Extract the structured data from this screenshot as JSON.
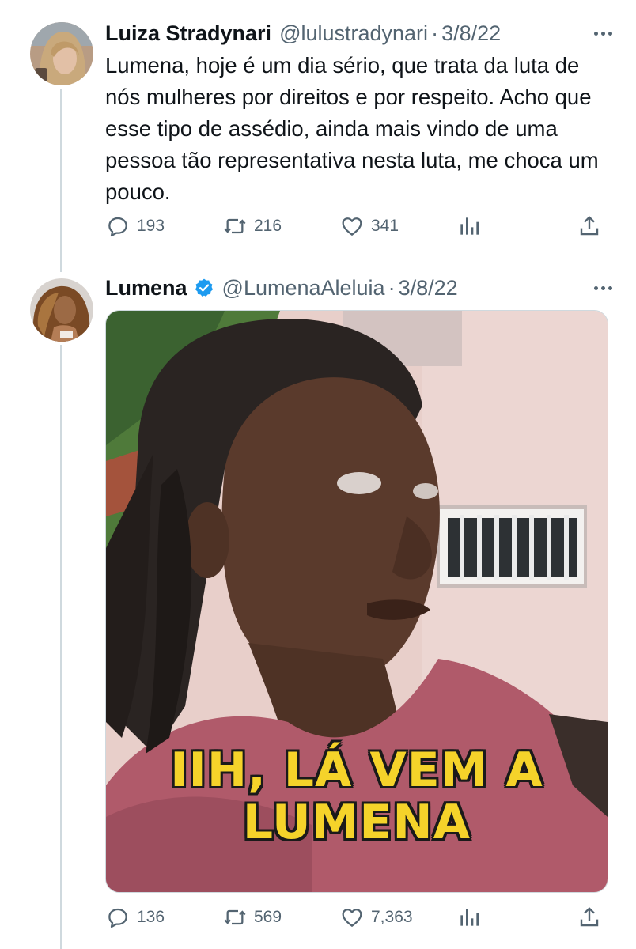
{
  "tweets": [
    {
      "name": "Luiza Stradynari",
      "handle": "@lulustradynari",
      "separator": "·",
      "date": "3/8/22",
      "verified": false,
      "text": "Lumena, hoje é um dia sério, que trata da luta de nós mulheres por direitos e por respeito. Acho que esse tipo de assédio, ainda mais vindo de uma pessoa tão representativa nesta luta, me choca um pouco.",
      "replies": "193",
      "retweets": "216",
      "likes": "341",
      "icons": [
        "reply-icon",
        "retweet-icon",
        "like-icon",
        "views-icon",
        "share-icon"
      ]
    },
    {
      "name": "Lumena",
      "handle": "@LumenaAleluia",
      "separator": "·",
      "date": "3/8/22",
      "verified": true,
      "media_caption_line1": "IIH, LÁ VEM A",
      "media_caption_line2": "LUMENA",
      "replies": "136",
      "retweets": "569",
      "likes": "7,363",
      "icons": [
        "reply-icon",
        "retweet-icon",
        "like-icon",
        "views-icon",
        "share-icon"
      ]
    }
  ],
  "colors": {
    "text": "#0f1419",
    "secondary": "#536471",
    "verified_badge": "#1d9bf0",
    "thread_line": "#cfd9de",
    "caption": "#f5d32a"
  }
}
